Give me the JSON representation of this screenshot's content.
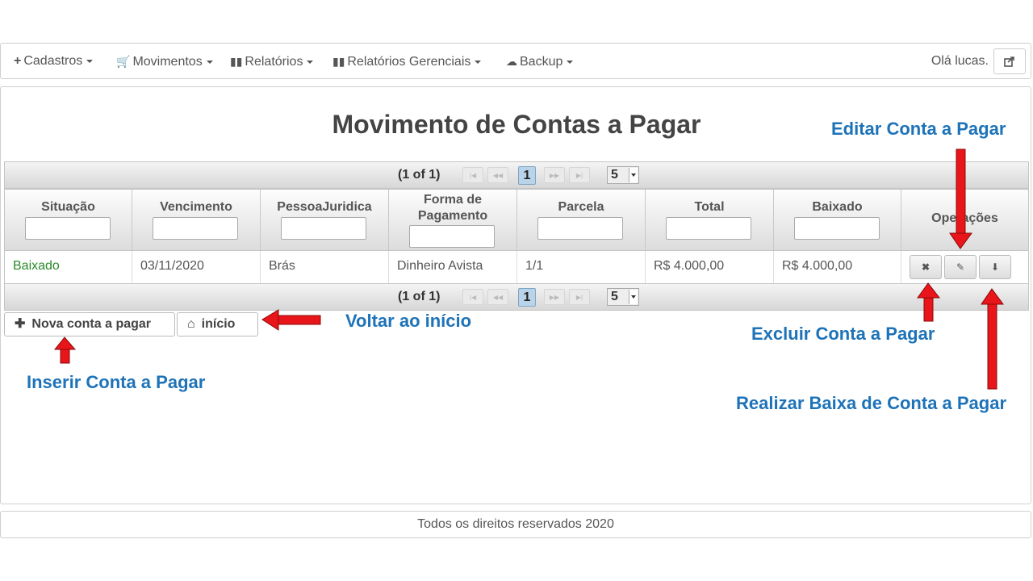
{
  "navbar": {
    "items": [
      {
        "icon": "plus-icon",
        "label": "Cadastros"
      },
      {
        "icon": "cart-icon",
        "label": "Movimentos"
      },
      {
        "icon": "bar-chart-icon",
        "label": "Relatórios"
      },
      {
        "icon": "bar-chart-icon",
        "label": "Relatórios Gerenciais"
      },
      {
        "icon": "cloud-download-icon",
        "label": "Backup"
      }
    ],
    "greeting": "Olá lucas."
  },
  "page": {
    "title": "Movimento de Contas a Pagar"
  },
  "paginator": {
    "text": "(1 of 1)",
    "current_page": "1",
    "rows_per_page": "5"
  },
  "table": {
    "columns": [
      "Situação",
      "Vencimento",
      "PessoaJuridica",
      "Forma de Pagamento",
      "Parcela",
      "Total",
      "Baixado",
      "Operações"
    ],
    "rows": [
      {
        "situacao": "Baixado",
        "vencimento": "03/11/2020",
        "pessoa": "Brás",
        "forma": "Dinheiro Avista",
        "parcela": "1/1",
        "total": "R$ 4.000,00",
        "baixado": "R$ 4.000,00"
      }
    ]
  },
  "buttons": {
    "new": "Nova conta a pagar",
    "home": "início"
  },
  "annotations": {
    "edit": "Editar Conta a Pagar",
    "back": "Voltar ao início",
    "delete": "Excluir Conta a Pagar",
    "insert": "Inserir Conta a Pagar",
    "settle": "Realizar Baixa de Conta a Pagar"
  },
  "footer": "Todos os direitos reservados 2020",
  "colors": {
    "status_green": "#2a8a2a",
    "annotation_blue": "#1e73b8",
    "arrow_red": "#e8151b"
  }
}
